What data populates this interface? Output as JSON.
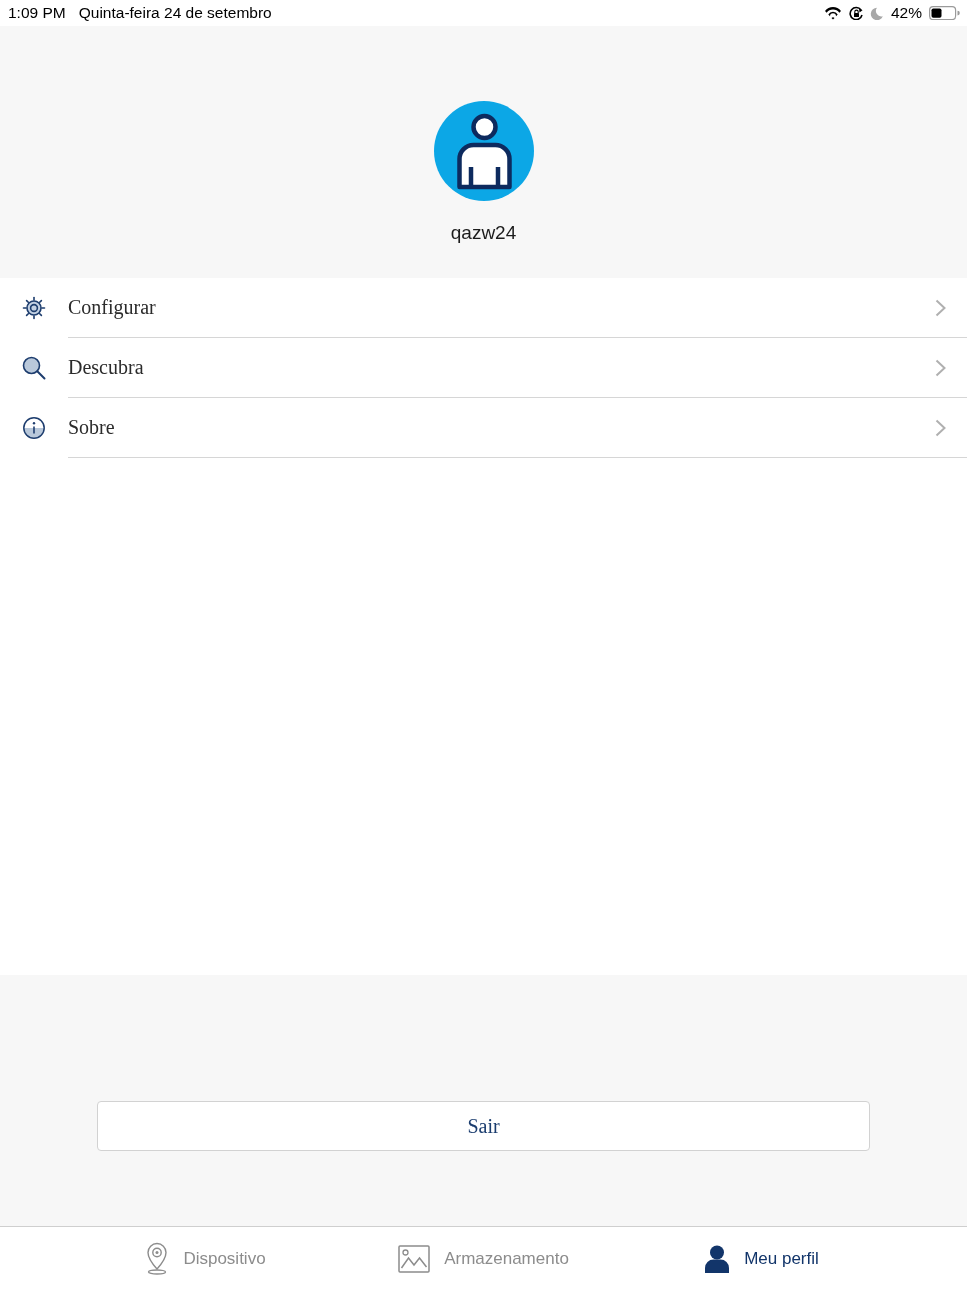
{
  "status_bar": {
    "time": "1:09 PM",
    "date": "Quinta-feira 24 de setembro",
    "battery": "42%"
  },
  "profile": {
    "username": "qazw24"
  },
  "menu": [
    {
      "kind": "settings",
      "label": "Configurar"
    },
    {
      "kind": "search",
      "label": "Descubra"
    },
    {
      "kind": "info",
      "label": "Sobre"
    }
  ],
  "logout_button": {
    "label": "Sair"
  },
  "tabs": [
    {
      "kind": "pin",
      "label": "Dispositivo",
      "selected": false
    },
    {
      "kind": "image",
      "label": "Armazenamento",
      "selected": false
    },
    {
      "kind": "person",
      "label": "Meu perfil",
      "selected": true
    }
  ]
}
